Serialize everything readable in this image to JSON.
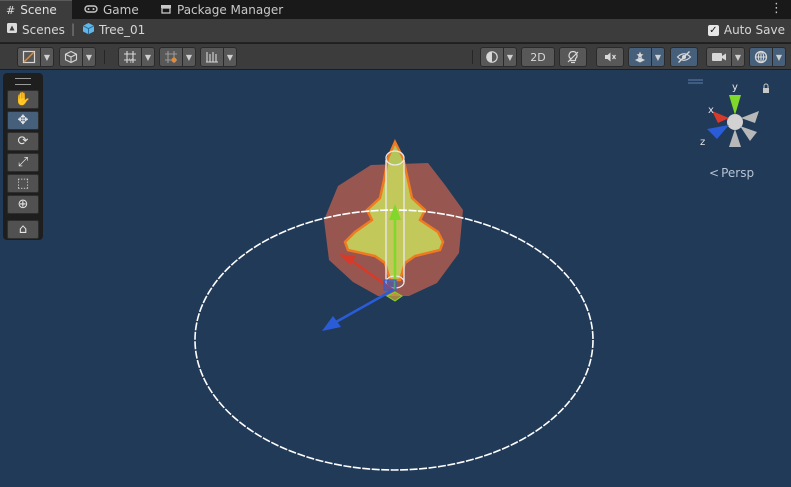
{
  "tabs": [
    {
      "label": "Scene",
      "icon": "grid-icon",
      "active": true
    },
    {
      "label": "Game",
      "icon": "gamepad-icon",
      "active": false
    },
    {
      "label": "Package Manager",
      "icon": "package-icon",
      "active": false
    }
  ],
  "tab_menu_label": "⋮",
  "breadcrumb": {
    "root": "Scenes",
    "root_icon": "unity-scene-icon",
    "separator": "|",
    "current": "Tree_01",
    "current_icon": "prefab-cube-icon"
  },
  "auto_save": {
    "label": "Auto Save",
    "checked": true,
    "check_glyph": "✓"
  },
  "toolbar": {
    "mode_2d_label": "2D",
    "dropdown_arrow": "▼"
  },
  "tools": [
    {
      "name": "hand-tool",
      "glyph": "✋",
      "active": false
    },
    {
      "name": "move-tool",
      "glyph": "✥",
      "active": true
    },
    {
      "name": "rotate-tool",
      "glyph": "⟳",
      "active": false
    },
    {
      "name": "scale-tool",
      "glyph": "⤢",
      "active": false
    },
    {
      "name": "rect-tool",
      "glyph": "⬚",
      "active": false
    },
    {
      "name": "transform-tool",
      "glyph": "⊕",
      "active": false
    },
    {
      "name": "custom-tool",
      "glyph": "⌂",
      "active": false
    }
  ],
  "gizmo": {
    "x_label": "x",
    "y_label": "y",
    "z_label": "z",
    "projection_label": "Persp",
    "projection_glyph": "<"
  },
  "colors": {
    "viewport_bg": "#213a58",
    "x_axis": "#d83a2a",
    "y_axis": "#7fd82a",
    "z_axis": "#2a5cd8",
    "selection_outline": "#f07a20",
    "tree_fill": "#c8d85a"
  }
}
